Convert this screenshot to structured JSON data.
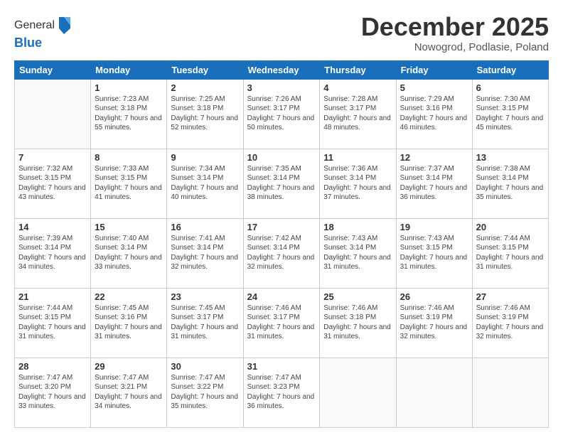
{
  "logo": {
    "general": "General",
    "blue": "Blue"
  },
  "title": "December 2025",
  "location": "Nowogrod, Podlasie, Poland",
  "days_of_week": [
    "Sunday",
    "Monday",
    "Tuesday",
    "Wednesday",
    "Thursday",
    "Friday",
    "Saturday"
  ],
  "weeks": [
    [
      {
        "day": "",
        "sunrise": "",
        "sunset": "",
        "daylight": ""
      },
      {
        "day": "1",
        "sunrise": "Sunrise: 7:23 AM",
        "sunset": "Sunset: 3:18 PM",
        "daylight": "Daylight: 7 hours and 55 minutes."
      },
      {
        "day": "2",
        "sunrise": "Sunrise: 7:25 AM",
        "sunset": "Sunset: 3:18 PM",
        "daylight": "Daylight: 7 hours and 52 minutes."
      },
      {
        "day": "3",
        "sunrise": "Sunrise: 7:26 AM",
        "sunset": "Sunset: 3:17 PM",
        "daylight": "Daylight: 7 hours and 50 minutes."
      },
      {
        "day": "4",
        "sunrise": "Sunrise: 7:28 AM",
        "sunset": "Sunset: 3:17 PM",
        "daylight": "Daylight: 7 hours and 48 minutes."
      },
      {
        "day": "5",
        "sunrise": "Sunrise: 7:29 AM",
        "sunset": "Sunset: 3:16 PM",
        "daylight": "Daylight: 7 hours and 46 minutes."
      },
      {
        "day": "6",
        "sunrise": "Sunrise: 7:30 AM",
        "sunset": "Sunset: 3:15 PM",
        "daylight": "Daylight: 7 hours and 45 minutes."
      }
    ],
    [
      {
        "day": "7",
        "sunrise": "Sunrise: 7:32 AM",
        "sunset": "Sunset: 3:15 PM",
        "daylight": "Daylight: 7 hours and 43 minutes."
      },
      {
        "day": "8",
        "sunrise": "Sunrise: 7:33 AM",
        "sunset": "Sunset: 3:15 PM",
        "daylight": "Daylight: 7 hours and 41 minutes."
      },
      {
        "day": "9",
        "sunrise": "Sunrise: 7:34 AM",
        "sunset": "Sunset: 3:14 PM",
        "daylight": "Daylight: 7 hours and 40 minutes."
      },
      {
        "day": "10",
        "sunrise": "Sunrise: 7:35 AM",
        "sunset": "Sunset: 3:14 PM",
        "daylight": "Daylight: 7 hours and 38 minutes."
      },
      {
        "day": "11",
        "sunrise": "Sunrise: 7:36 AM",
        "sunset": "Sunset: 3:14 PM",
        "daylight": "Daylight: 7 hours and 37 minutes."
      },
      {
        "day": "12",
        "sunrise": "Sunrise: 7:37 AM",
        "sunset": "Sunset: 3:14 PM",
        "daylight": "Daylight: 7 hours and 36 minutes."
      },
      {
        "day": "13",
        "sunrise": "Sunrise: 7:38 AM",
        "sunset": "Sunset: 3:14 PM",
        "daylight": "Daylight: 7 hours and 35 minutes."
      }
    ],
    [
      {
        "day": "14",
        "sunrise": "Sunrise: 7:39 AM",
        "sunset": "Sunset: 3:14 PM",
        "daylight": "Daylight: 7 hours and 34 minutes."
      },
      {
        "day": "15",
        "sunrise": "Sunrise: 7:40 AM",
        "sunset": "Sunset: 3:14 PM",
        "daylight": "Daylight: 7 hours and 33 minutes."
      },
      {
        "day": "16",
        "sunrise": "Sunrise: 7:41 AM",
        "sunset": "Sunset: 3:14 PM",
        "daylight": "Daylight: 7 hours and 32 minutes."
      },
      {
        "day": "17",
        "sunrise": "Sunrise: 7:42 AM",
        "sunset": "Sunset: 3:14 PM",
        "daylight": "Daylight: 7 hours and 32 minutes."
      },
      {
        "day": "18",
        "sunrise": "Sunrise: 7:43 AM",
        "sunset": "Sunset: 3:14 PM",
        "daylight": "Daylight: 7 hours and 31 minutes."
      },
      {
        "day": "19",
        "sunrise": "Sunrise: 7:43 AM",
        "sunset": "Sunset: 3:15 PM",
        "daylight": "Daylight: 7 hours and 31 minutes."
      },
      {
        "day": "20",
        "sunrise": "Sunrise: 7:44 AM",
        "sunset": "Sunset: 3:15 PM",
        "daylight": "Daylight: 7 hours and 31 minutes."
      }
    ],
    [
      {
        "day": "21",
        "sunrise": "Sunrise: 7:44 AM",
        "sunset": "Sunset: 3:15 PM",
        "daylight": "Daylight: 7 hours and 31 minutes."
      },
      {
        "day": "22",
        "sunrise": "Sunrise: 7:45 AM",
        "sunset": "Sunset: 3:16 PM",
        "daylight": "Daylight: 7 hours and 31 minutes."
      },
      {
        "day": "23",
        "sunrise": "Sunrise: 7:45 AM",
        "sunset": "Sunset: 3:17 PM",
        "daylight": "Daylight: 7 hours and 31 minutes."
      },
      {
        "day": "24",
        "sunrise": "Sunrise: 7:46 AM",
        "sunset": "Sunset: 3:17 PM",
        "daylight": "Daylight: 7 hours and 31 minutes."
      },
      {
        "day": "25",
        "sunrise": "Sunrise: 7:46 AM",
        "sunset": "Sunset: 3:18 PM",
        "daylight": "Daylight: 7 hours and 31 minutes."
      },
      {
        "day": "26",
        "sunrise": "Sunrise: 7:46 AM",
        "sunset": "Sunset: 3:19 PM",
        "daylight": "Daylight: 7 hours and 32 minutes."
      },
      {
        "day": "27",
        "sunrise": "Sunrise: 7:46 AM",
        "sunset": "Sunset: 3:19 PM",
        "daylight": "Daylight: 7 hours and 32 minutes."
      }
    ],
    [
      {
        "day": "28",
        "sunrise": "Sunrise: 7:47 AM",
        "sunset": "Sunset: 3:20 PM",
        "daylight": "Daylight: 7 hours and 33 minutes."
      },
      {
        "day": "29",
        "sunrise": "Sunrise: 7:47 AM",
        "sunset": "Sunset: 3:21 PM",
        "daylight": "Daylight: 7 hours and 34 minutes."
      },
      {
        "day": "30",
        "sunrise": "Sunrise: 7:47 AM",
        "sunset": "Sunset: 3:22 PM",
        "daylight": "Daylight: 7 hours and 35 minutes."
      },
      {
        "day": "31",
        "sunrise": "Sunrise: 7:47 AM",
        "sunset": "Sunset: 3:23 PM",
        "daylight": "Daylight: 7 hours and 36 minutes."
      },
      {
        "day": "",
        "sunrise": "",
        "sunset": "",
        "daylight": ""
      },
      {
        "day": "",
        "sunrise": "",
        "sunset": "",
        "daylight": ""
      },
      {
        "day": "",
        "sunrise": "",
        "sunset": "",
        "daylight": ""
      }
    ]
  ]
}
